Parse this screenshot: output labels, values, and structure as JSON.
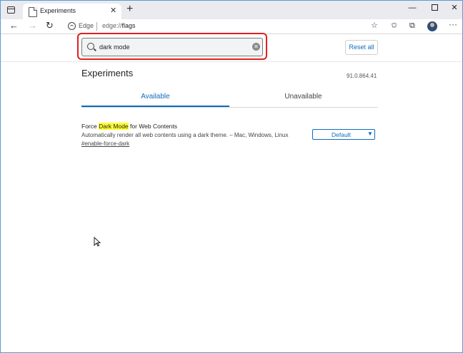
{
  "browser": {
    "tab_title": "Experiments",
    "edge_label": "Edge",
    "url_scheme": "edge://",
    "url_path": "flags"
  },
  "flags_page": {
    "search_value": "dark mode",
    "reset_all_label": "Reset all",
    "title": "Experiments",
    "version": "91.0.864.41",
    "tabs": [
      {
        "label": "Available",
        "selected": true
      },
      {
        "label": "Unavailable",
        "selected": false
      }
    ]
  },
  "flag": {
    "title_prefix": "Force ",
    "title_highlight": "Dark Mode",
    "title_suffix": " for Web Contents",
    "description": "Automatically render all web contents using a dark theme. – Mac, Windows, Linux",
    "link": "#enable-force-dark",
    "selected_option": "Default"
  },
  "colors": {
    "accent": "#0f6cbd",
    "highlight_box": "#e0201e",
    "search_highlight": "#ffff33"
  },
  "icons": [
    "tab-actions-icon",
    "page-icon",
    "close-icon",
    "plus-icon",
    "minimize-icon",
    "maximize-icon",
    "back-icon",
    "forward-icon",
    "reload-icon",
    "edge-icon",
    "favorite-add-icon",
    "favorites-icon",
    "collections-icon",
    "profile-icon",
    "more-icon",
    "search-icon",
    "clear-icon",
    "chevron-down-icon",
    "cursor-icon"
  ]
}
